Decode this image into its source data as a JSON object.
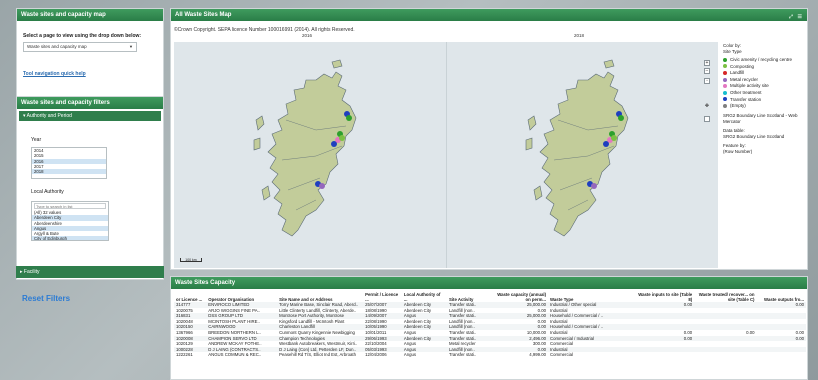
{
  "select_panel": {
    "title": "Waste sites and capacity map",
    "instruction": "Select a page to view using the drop down below:",
    "dropdown_value": "Waste sites and capacity map",
    "help_link": "Tool navigation quick help"
  },
  "filters_panel": {
    "title": "Waste sites and capacity filters",
    "section": "Authority and Period",
    "year_label": "Year",
    "years": [
      "2014",
      "2015",
      "2016",
      "2017",
      "2018"
    ],
    "selected_years": [
      "2016",
      "2018"
    ],
    "authority_label": "Local Authority",
    "authority_search_placeholder": "Type to search in list",
    "authorities": [
      "(All) 32 values",
      "Aberdeen City",
      "Aberdeenshire",
      "Angus",
      "Argyll & Bute",
      "City of Edinburgh"
    ],
    "selected_authorities": [
      "Aberdeen City",
      "Angus",
      "City of Edinburgh"
    ],
    "facility_section": "Facility",
    "reset": "Reset Filters"
  },
  "map_panel": {
    "title": "All Waste Sites Map",
    "copyright": "©Crown Copyright. SEPA licence Number 100016991 (2014). All rights Reserved.",
    "left_year": "2016",
    "right_year": "2018",
    "scale": "100 km",
    "legend": {
      "color_by": "Color by:",
      "site_type": "Site Type",
      "items": [
        {
          "label": "Civic amenity / recycling centre",
          "color": "#2ca02c"
        },
        {
          "label": "Composting",
          "color": "#7bc043"
        },
        {
          "label": "Landfill",
          "color": "#d62728"
        },
        {
          "label": "Metal recycler",
          "color": "#9467bd"
        },
        {
          "label": "Multiple activity site",
          "color": "#e377c2"
        },
        {
          "label": "Other treatment",
          "color": "#17becf"
        },
        {
          "label": "Transfer station",
          "color": "#1f3fbf"
        },
        {
          "label": "(Empty)",
          "color": "#7f7f7f"
        }
      ],
      "boundary_title": "SRG2 Boundary Line Scotland - Web Mercator",
      "data_table_label": "Data table:",
      "data_table_value": "SRG2 Boundary Line Scotland",
      "feature_by_label": "Feature by:",
      "feature_by_value": "(Row Number)"
    },
    "colors": {
      "sea": "#dfe6ea",
      "land": "#c2cc9a",
      "border": "#5a6a75"
    }
  },
  "table_panel": {
    "title": "Waste Sites Capacity",
    "columns": [
      "or Licence ...",
      "Operator Organisation",
      "Site Name and or Address",
      "Permit / Licence ...",
      "Local Authority of ...",
      "Site Activity",
      "Waste capacity (annual) on perm...",
      "Waste Type",
      "Waste inputs to site (Table 8)",
      "Waste treated/ recover... on site (Table C)",
      "Waste outputs fro..."
    ],
    "rows": [
      [
        "314777",
        "ENVIROCO LIMITED",
        "Torry Marine Base, Sinclair Road, Aberd..",
        "25/07/2007",
        "Aberdeen City",
        "Transfer stati..",
        "25,000.00",
        "Industrial / Other special",
        "0.00",
        "",
        "0.00"
      ],
      [
        "1020075",
        "ARJO WIGGINS FINE PA..",
        "Little Clinterty Landfill, Clinterty, Aberde..",
        "18/08/1990",
        "Aberdeen City",
        "Landfill (non..",
        "0.00",
        "Industrial",
        "",
        "",
        ""
      ],
      [
        "316831",
        "DSS GROUP LTD",
        "Montrose Port Authority, Montrose",
        "14/09/2007",
        "Angus",
        "Transfer stati..",
        "25,000.00",
        "Household / Commercial / ..",
        "",
        "",
        ""
      ],
      [
        "1020048",
        "MCINTOSH PLANT HIRE..",
        "Kingsford Landfill - McIntosh Plant",
        "22/08/1990",
        "Aberdeen City",
        "Landfill (non..",
        "0.00",
        "Industrial",
        "",
        "",
        ""
      ],
      [
        "1020150",
        "CAIRNWOOD",
        "Charleston Landfill",
        "10/05/1990",
        "Aberdeen City",
        "Landfill (non..",
        "0.00",
        "Household / Commercial / ..",
        "",
        "",
        ""
      ],
      [
        "1367966",
        "BREEDON NORTHERN L..",
        "Cunmont Quarry Kingennie Newbigging",
        "10/01/2011",
        "Angus",
        "Transfer stati..",
        "10,000.00",
        "Industrial",
        "0.00",
        "0.00",
        "0.00"
      ],
      [
        "1020008",
        "CHAMPION SERVO LTD",
        "Champion Technologies",
        "29/06/1993",
        "Aberdeen City",
        "Transfer stati..",
        "2,496.00",
        "Commercial / Industrial",
        "0.00",
        "",
        "0.00"
      ],
      [
        "1020129",
        "ANDREW MCKAY FOTHE..",
        "Westbank Autobreakers, Westmuir, Kirri..",
        "22/10/2004",
        "Angus",
        "Metal recycler",
        "300.00",
        "Commercial",
        "",
        "",
        ""
      ],
      [
        "1000228",
        "D J LAING (CONTRACTS..",
        "D J Laing (Con) Ltd, Petterden LF, Dun..",
        "05/03/1993",
        "Angus",
        "Landfill (non..",
        "0.00",
        "Industrial",
        "",
        "",
        ""
      ],
      [
        "1222261",
        "ANGUS COMMUN & REC..",
        "Peasehill Rd T/S, Elliot Ind Est, Arbroath",
        "12/04/2006",
        "Angus",
        "Transfer stati..",
        "4,999.00",
        "Commercial",
        "",
        "",
        ""
      ]
    ]
  }
}
